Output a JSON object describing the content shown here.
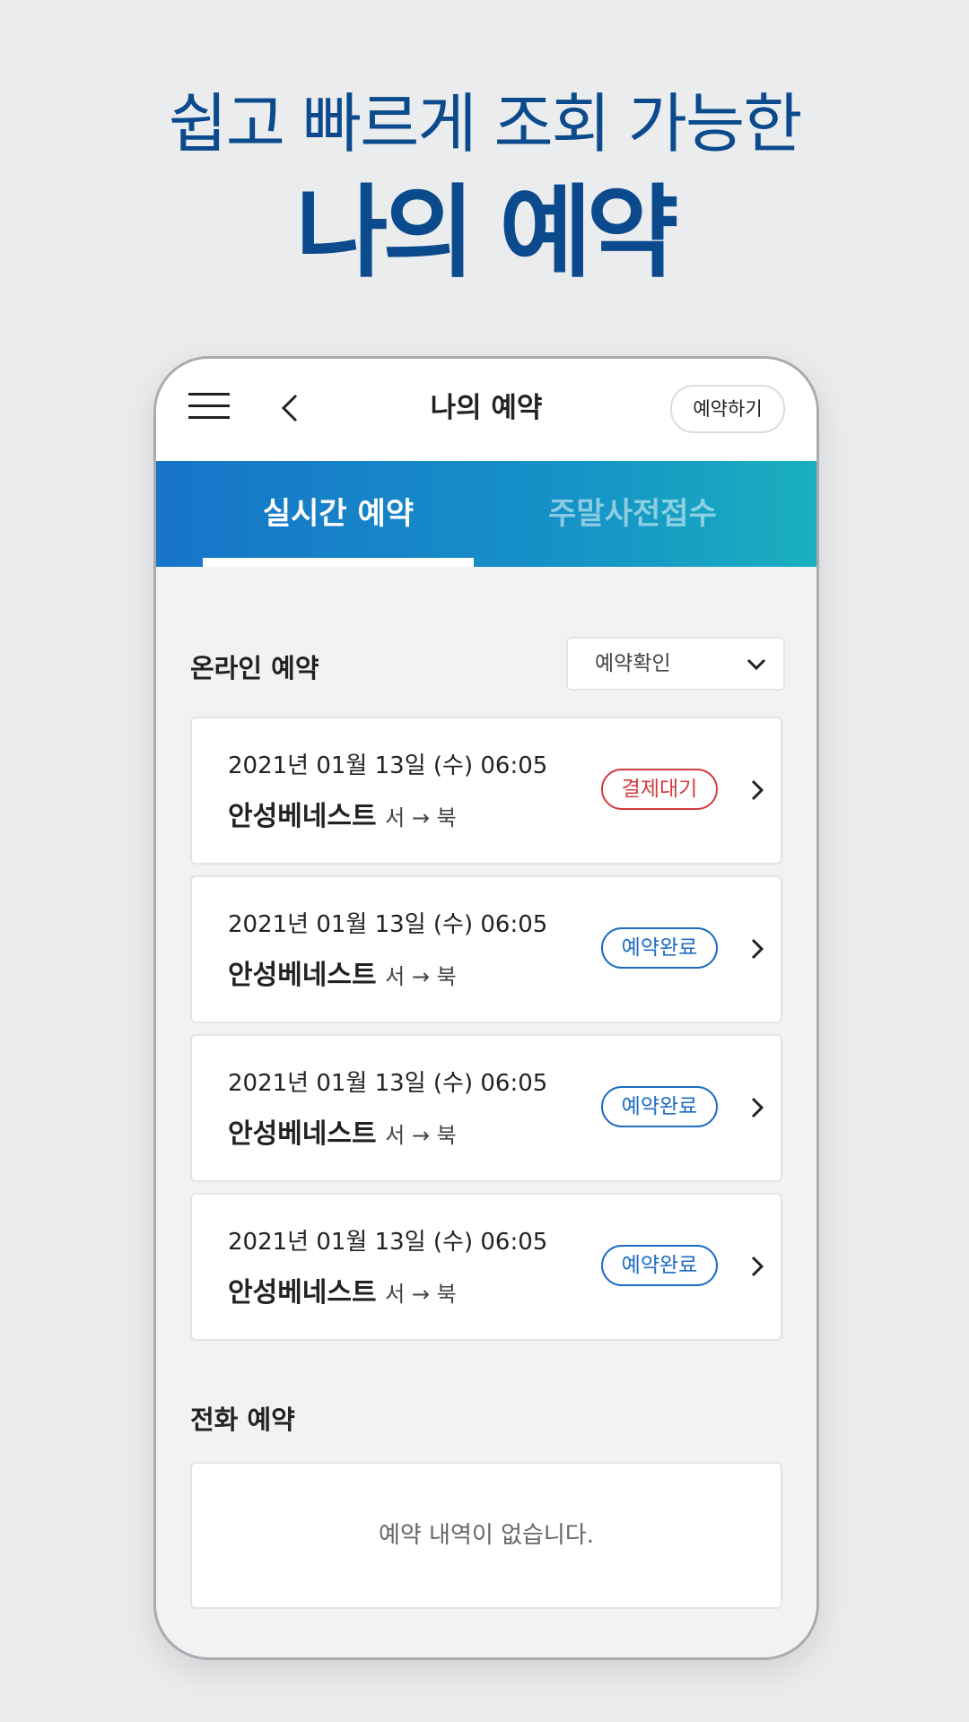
{
  "promo": {
    "subtitle": "쉽고 빠르게  조회 가능한",
    "title": "나의 예약"
  },
  "appbar": {
    "title": "나의 예약",
    "reserve_button": "예약하기"
  },
  "tabs": [
    {
      "label": "실시간 예약",
      "active": true
    },
    {
      "label": "주말사전접수",
      "active": false
    }
  ],
  "online": {
    "title": "온라인 예약",
    "filter": "예약확인",
    "items": [
      {
        "date": "2021년 01월 13일 (수) 06:05",
        "course": "안성베네스트",
        "direction": "서 → 북",
        "status": "결제대기",
        "status_color": "#d33c3c"
      },
      {
        "date": "2021년 01월 13일 (수) 06:05",
        "course": "안성베네스트",
        "direction": "서 → 북",
        "status": "예약완료",
        "status_color": "#1c6cc2"
      },
      {
        "date": "2021년 01월 13일 (수) 06:05",
        "course": "안성베네스트",
        "direction": "서 → 북",
        "status": "예약완료",
        "status_color": "#1c6cc2"
      },
      {
        "date": "2021년 01월 13일 (수) 06:05",
        "course": "안성베네스트",
        "direction": "서 → 북",
        "status": "예약완료",
        "status_color": "#1c6cc2"
      }
    ]
  },
  "phone_reservation": {
    "title": "전화 예약",
    "empty_message": "예약 내역이 없습니다."
  },
  "colors": {
    "brand_blue": "#0b4a8c",
    "tab_gradient_start": "#1774c9",
    "tab_gradient_end": "#1aafbf"
  }
}
